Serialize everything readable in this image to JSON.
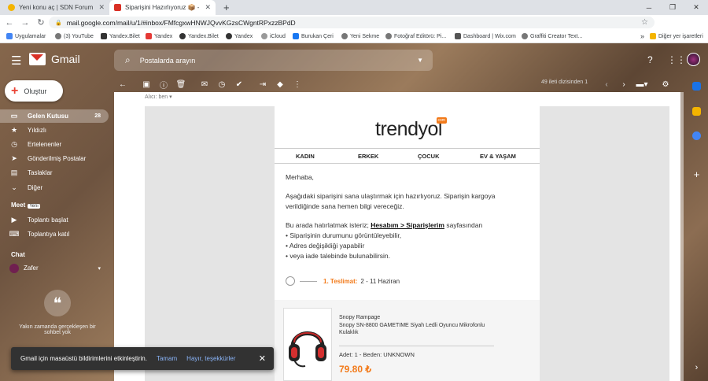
{
  "browser": {
    "tabs": [
      {
        "title": "Yeni konu aç | SDN Forum",
        "color": "#f4b400"
      },
      {
        "title": "Siparişini Hazırlıyoruz 📦 - zafer",
        "color": "#d93025"
      }
    ],
    "new_tab": "+",
    "url": "mail.google.com/mail/u/1/#inbox/FMfcgxwHNWJQvvKGzsCWgntRPxzzBPdD",
    "bookmarks": [
      "Uygulamalar",
      "(3) YouTube",
      "Yandex.Bilet",
      "Yandex",
      "Yandex.Bilet",
      "Yandex",
      "iCloud",
      "Burukan Çeri",
      "Yeni Sekme",
      "Fotoğraf Editörü: Pi...",
      "Dashboard | Wix.com",
      "Graffiti Creator Text..."
    ],
    "other_bookmarks": "Diğer yer işaretleri"
  },
  "gmail": {
    "brand": "Gmail",
    "search_placeholder": "Postalarda arayın",
    "compose": "Oluştur",
    "nav": [
      {
        "label": "Gelen Kutusu",
        "icon": "inbox-icon",
        "count": "28",
        "selected": true
      },
      {
        "label": "Yıldızlı",
        "icon": "star-icon"
      },
      {
        "label": "Ertelenenler",
        "icon": "clock-icon"
      },
      {
        "label": "Gönderilmiş Postalar",
        "icon": "send-icon"
      },
      {
        "label": "Taslaklar",
        "icon": "draft-icon"
      },
      {
        "label": "Diğer",
        "icon": "chevron-down-icon"
      }
    ],
    "meet": {
      "title": "Meet",
      "badge": "Yeni",
      "items": [
        "Toplantı başlat",
        "Toplantıya katıl"
      ]
    },
    "chat": {
      "title": "Chat",
      "user": "Zafer",
      "empty": "Yakın zamanda gerçekleşen bir sohbet yok"
    },
    "pager": "49 ileti dizisinden 1",
    "snackbar": {
      "text": "Gmail için masaüstü bildirimlerini etkinleştirin.",
      "ok": "Tamam",
      "no": "Hayır, teşekkürler"
    }
  },
  "email": {
    "to": "Alıcı: ben",
    "brand": "trendyol",
    "brand_badge": "com",
    "categories": [
      "KADIN",
      "ERKEK",
      "ÇOCUK",
      "EV & YAŞAM"
    ],
    "greeting": "Merhaba,",
    "p1_line1": "Aşağıdaki siparişini sana ulaştırmak için hazırlıyoruz. Siparişin kargoya",
    "p1_line2": "verildiğinde sana hemen bilgi vereceğiz.",
    "p2_pre": "Bu arada hatırlatmak isteriz; ",
    "p2_link": "Hesabım > Siparişlerim",
    "p2_post": " sayfasından",
    "bullets": [
      "• Siparişinin durumunu görüntüleyebilir,",
      "• Adres değişikliği yapabilir",
      "• veya iade talebinde bulunabilirsin."
    ],
    "delivery_label": "1. Teslimat:",
    "delivery_date": "2 - 11 Haziran",
    "product": {
      "brand": "Snopy Rampage",
      "name_line1": "Snopy SN-8800 GAMETIME Siyah Ledli Oyuncu Mikrofonlu",
      "name_line2": "Kulaklık",
      "qty": "Adet: 1 - Beden: UNKNOWN",
      "price": "79.80 ₺"
    }
  },
  "colors": {
    "accent": "#f27a1a",
    "gmail_red": "#d93025"
  }
}
